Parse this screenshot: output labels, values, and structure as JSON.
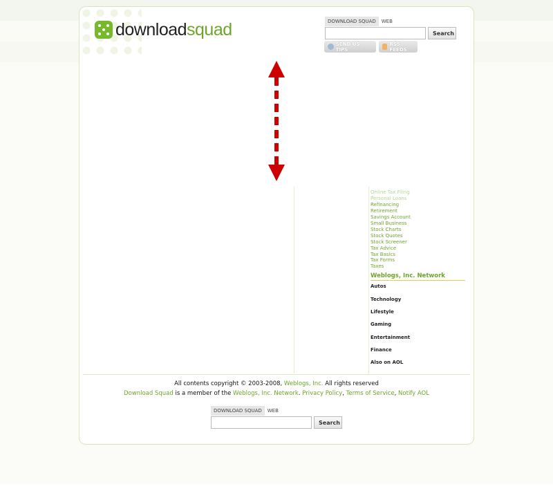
{
  "header": {
    "logo_part1": "download",
    "logo_part2": "squad"
  },
  "search": {
    "tabs": [
      "DOWNLOAD SQUAD",
      "WEB"
    ],
    "button_label": "Search",
    "value": ""
  },
  "pills": {
    "tips_label": "SEND US TIPS",
    "rss_label": "RSS FEEDS"
  },
  "sidebar": {
    "links": [
      "Online Tax Filing",
      "Personal Loans",
      "Refinancing",
      "Retirement",
      "Savings Account",
      "Small Business",
      "Stock Charts",
      "Stock Quotes",
      "Stock Screener",
      "Tax Advice",
      "Tax Basics",
      "Tax Forms",
      "Taxes"
    ],
    "network_heading": "Weblogs, Inc. Network",
    "network_items": [
      "Autos",
      "Technology",
      "Lifestyle",
      "Gaming",
      "Entertainment",
      "Finance",
      "Also on AOL"
    ]
  },
  "footer": {
    "copyright_prefix": "All contents copyright © 2003-2008,",
    "weblogs_link": "Weblogs, Inc.",
    "copyright_suffix": "All rights reserved",
    "site_link": "Download Squad",
    "member_text": "is a member of the",
    "network_link": "Weblogs, Inc. Network",
    "privacy_link": "Privacy Policy",
    "terms_link": "Terms of Service",
    "notify_link": "Notify AOL"
  },
  "colors": {
    "brand_green": "#6ea52b",
    "arrow_red": "#cc0000"
  }
}
